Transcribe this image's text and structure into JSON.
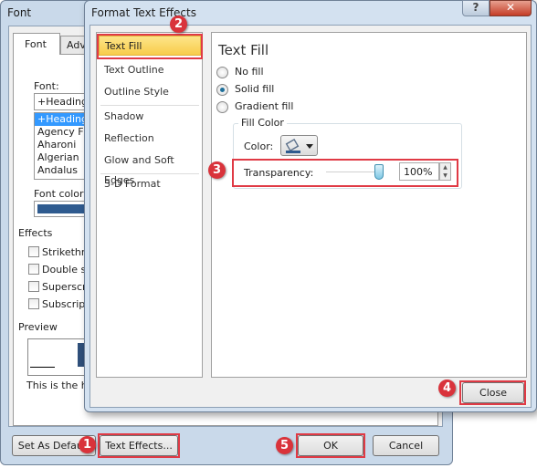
{
  "font_dialog": {
    "title": "Font",
    "tabs": [
      "Font",
      "Adv"
    ],
    "font_label": "Font:",
    "font_value": "+Headings",
    "font_list": [
      "+Headings",
      "Agency FB",
      "Aharoni",
      "Algerian",
      "Andalus"
    ],
    "font_color_label": "Font color:",
    "font_color": "#2f5b8f",
    "effects_label": "Effects",
    "effects": [
      "Strikethro",
      "Double st",
      "Superscri",
      "Subscript"
    ],
    "preview_label": "Preview",
    "preview_text": "This is the he",
    "set_default": "Set As Default",
    "text_effects": "Text Effects...",
    "ok": "OK",
    "cancel": "Cancel"
  },
  "effects_dialog": {
    "title": "Format Text Effects",
    "help": "?",
    "close_x": "✕",
    "categories": [
      "Text Fill",
      "Text Outline",
      "Outline Style",
      "Shadow",
      "Reflection",
      "Glow and Soft Edges",
      "3-D Format"
    ],
    "selected": "Text Fill",
    "heading": "Text Fill",
    "fill_options": [
      "No fill",
      "Solid fill",
      "Gradient fill"
    ],
    "selected_fill": "Solid fill",
    "fill_color_group": "Fill Color",
    "color_label": "Color:",
    "transparency_label": "Transparency:",
    "transparency_value": "100%",
    "transparency_percent": 100,
    "close": "Close"
  },
  "badges": [
    "1",
    "2",
    "3",
    "4",
    "5"
  ],
  "colors": {
    "highlight": "#fbd75a",
    "annotation": "#e03a45"
  }
}
